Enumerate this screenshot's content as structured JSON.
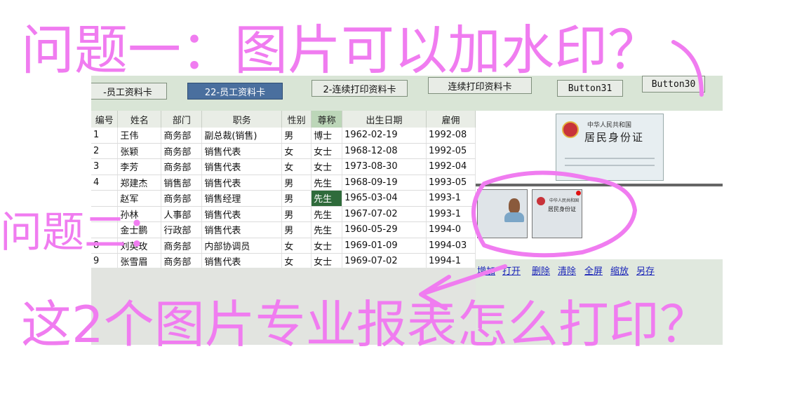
{
  "toolbar": {
    "buttons": [
      {
        "label": "-员工资料卡"
      },
      {
        "label": "22-员工资料卡"
      },
      {
        "label": "2-连续打印资料卡"
      },
      {
        "label": "连续打印资料卡"
      },
      {
        "label": "Button31"
      },
      {
        "label": "Button30"
      }
    ]
  },
  "table": {
    "headers": [
      "编号",
      "姓名",
      "部门",
      "职务",
      "性别",
      "尊称",
      "出生日期",
      "雇佣"
    ],
    "rows": [
      [
        "1",
        "王伟",
        "商务部",
        "副总裁(销售)",
        "男",
        "博士",
        "1962-02-19",
        "1992-08"
      ],
      [
        "2",
        "张颖",
        "商务部",
        "销售代表",
        "女",
        "女士",
        "1968-12-08",
        "1992-05"
      ],
      [
        "3",
        "李芳",
        "商务部",
        "销售代表",
        "女",
        "女士",
        "1973-08-30",
        "1992-04"
      ],
      [
        "4",
        "郑建杰",
        "销售部",
        "销售代表",
        "男",
        "先生",
        "1968-09-19",
        "1993-05"
      ],
      [
        "",
        "赵军",
        "商务部",
        "销售经理",
        "男",
        "先生",
        "1965-03-04",
        "1993-1"
      ],
      [
        "",
        "孙林",
        "人事部",
        "销售代表",
        "男",
        "先生",
        "1967-07-02",
        "1993-1"
      ],
      [
        "",
        "金士鹏",
        "行政部",
        "销售代表",
        "男",
        "先生",
        "1960-05-29",
        "1994-0"
      ],
      [
        "8",
        "刘英玫",
        "商务部",
        "内部协调员",
        "女",
        "女士",
        "1969-01-09",
        "1994-03"
      ],
      [
        "9",
        "张雪眉",
        "商务部",
        "销售代表",
        "女",
        "女士",
        "1969-07-02",
        "1994-1"
      ]
    ]
  },
  "id_card": {
    "line1": "中华人民共和国",
    "line2": "居民身份证"
  },
  "thumb_card": {
    "line1": "中华人民共和国",
    "line2": "居民身份证"
  },
  "links": [
    "增加",
    "打开",
    "删除",
    "清除",
    "全屏",
    "缩放",
    "另存"
  ],
  "annotations": {
    "q1": "问题一：图片可以加水印？",
    "q2": "问题二：",
    "q3": "这2个图片专业报表怎么打印？"
  },
  "colors": {
    "annotation": "#f07cf0",
    "active_button": "#4a6f9e",
    "selected_cell": "#2f6b3b",
    "link": "#1a24b8"
  }
}
